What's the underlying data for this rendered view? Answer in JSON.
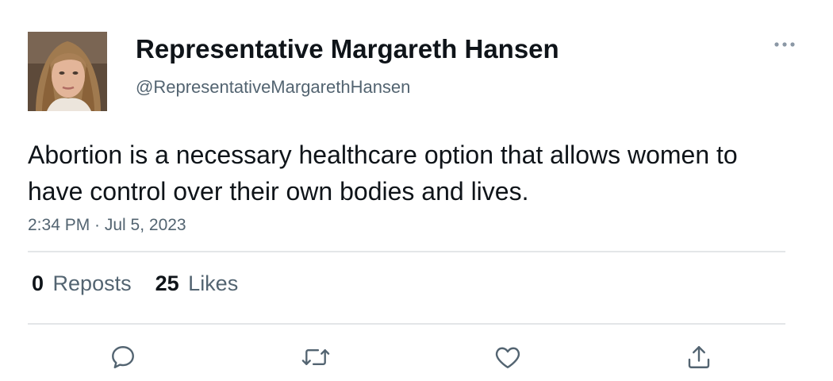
{
  "author": {
    "display_name": "Representative Margareth Hansen",
    "handle": "@RepresentativeMargarethHansen",
    "avatar_icon": "profile-photo"
  },
  "post": {
    "text": "Abortion is a necessary healthcare option that allows women to have control over their own bodies and lives.",
    "timestamp": "2:34 PM · Jul 5, 2023"
  },
  "stats": {
    "reposts_count": "0",
    "reposts_label": "Reposts",
    "likes_count": "25",
    "likes_label": "Likes"
  },
  "actions": {
    "more_icon": "more-horizontal-icon",
    "reply_icon": "reply-icon",
    "repost_icon": "repost-icon",
    "like_icon": "heart-icon",
    "share_icon": "share-icon"
  },
  "colors": {
    "text_primary": "#0f1419",
    "text_secondary": "#536471",
    "divider": "#e3e6e8"
  }
}
